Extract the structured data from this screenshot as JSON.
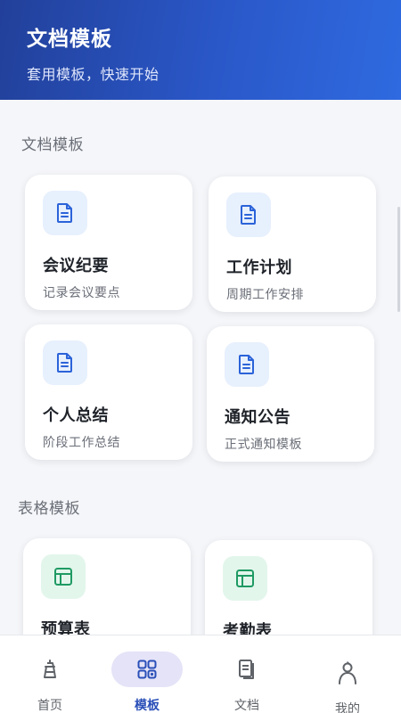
{
  "header": {
    "title": "文档模板",
    "subtitle": "套用模板，快速开始"
  },
  "sections": [
    {
      "title": "文档模板",
      "cards": [
        {
          "title": "会议纪要",
          "desc": "记录会议要点",
          "icon": "document-icon"
        },
        {
          "title": "工作计划",
          "desc": "周期工作安排",
          "icon": "document-icon"
        },
        {
          "title": "个人总结",
          "desc": "阶段工作总结",
          "icon": "document-icon"
        },
        {
          "title": "通知公告",
          "desc": "正式通知模板",
          "icon": "document-icon"
        }
      ]
    },
    {
      "title": "表格模板",
      "cards": [
        {
          "title": "预算表",
          "desc": "",
          "icon": "table-icon"
        },
        {
          "title": "考勤表",
          "desc": "",
          "icon": "table-icon"
        }
      ]
    }
  ],
  "nav": {
    "active": "模板",
    "items": [
      {
        "label": "首页",
        "icon": "home-icon"
      },
      {
        "label": "模板",
        "icon": "grid-icon"
      },
      {
        "label": "文档",
        "icon": "files-icon"
      },
      {
        "label": "我的",
        "icon": "person-icon"
      }
    ]
  },
  "colors": {
    "header_gradient_start": "#22409a",
    "header_gradient_end": "#2f6ae0",
    "doc_icon_accent": "#2b63d9",
    "table_icon_accent": "#1f9a63",
    "nav_active": "#2a4fb8"
  }
}
